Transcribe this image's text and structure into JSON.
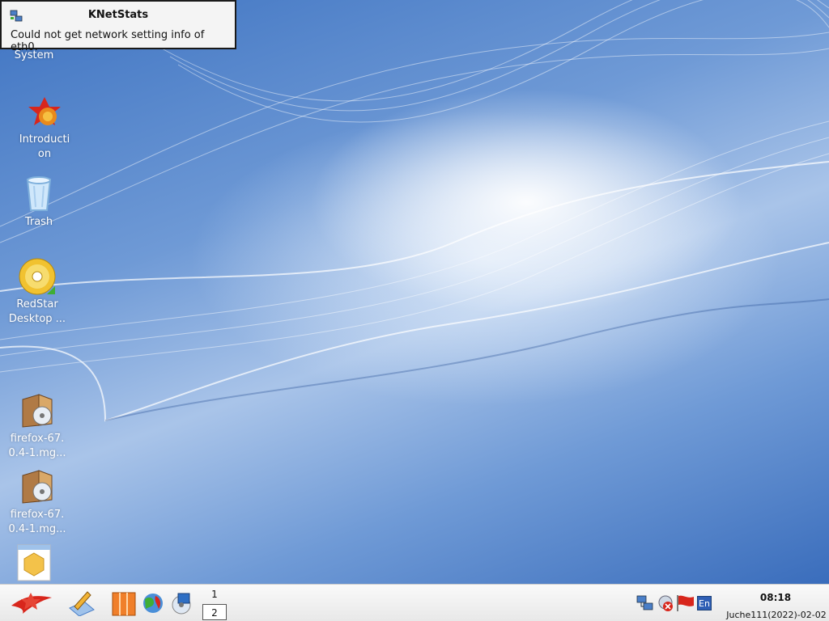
{
  "notification": {
    "title": "KNetStats",
    "message": "Could not get network setting info of eth0.",
    "icon": "network-icon"
  },
  "desktop_icons": [
    {
      "label": "System",
      "icon": "system-icon"
    },
    {
      "label": "Introducti\non",
      "icon": "redstar-introduction-icon"
    },
    {
      "label": "Trash",
      "icon": "trash-icon"
    },
    {
      "label": "RedStar\nDesktop ...",
      "icon": "cd-disc-icon"
    },
    {
      "label": "firefox-67.\n0.4-1.mg...",
      "icon": "package-icon"
    },
    {
      "label": "firefox-67.\n0.4-1.mg...",
      "icon": "package-icon"
    },
    {
      "label": "",
      "icon": "document-package-icon"
    }
  ],
  "taskbar": {
    "start_icon": "redstar-start-icon",
    "launchers": [
      "text-editor-icon",
      "file-manager-icon",
      "web-browser-icon",
      "media-player-icon"
    ],
    "pager": [
      "1",
      "2"
    ],
    "tray": [
      "network-status-icon",
      "network-error-icon",
      "flag-icon",
      "input-method-icon"
    ],
    "input_method_label": "En",
    "clock": "08:18",
    "date": "Juche111(2022)-02-02"
  }
}
